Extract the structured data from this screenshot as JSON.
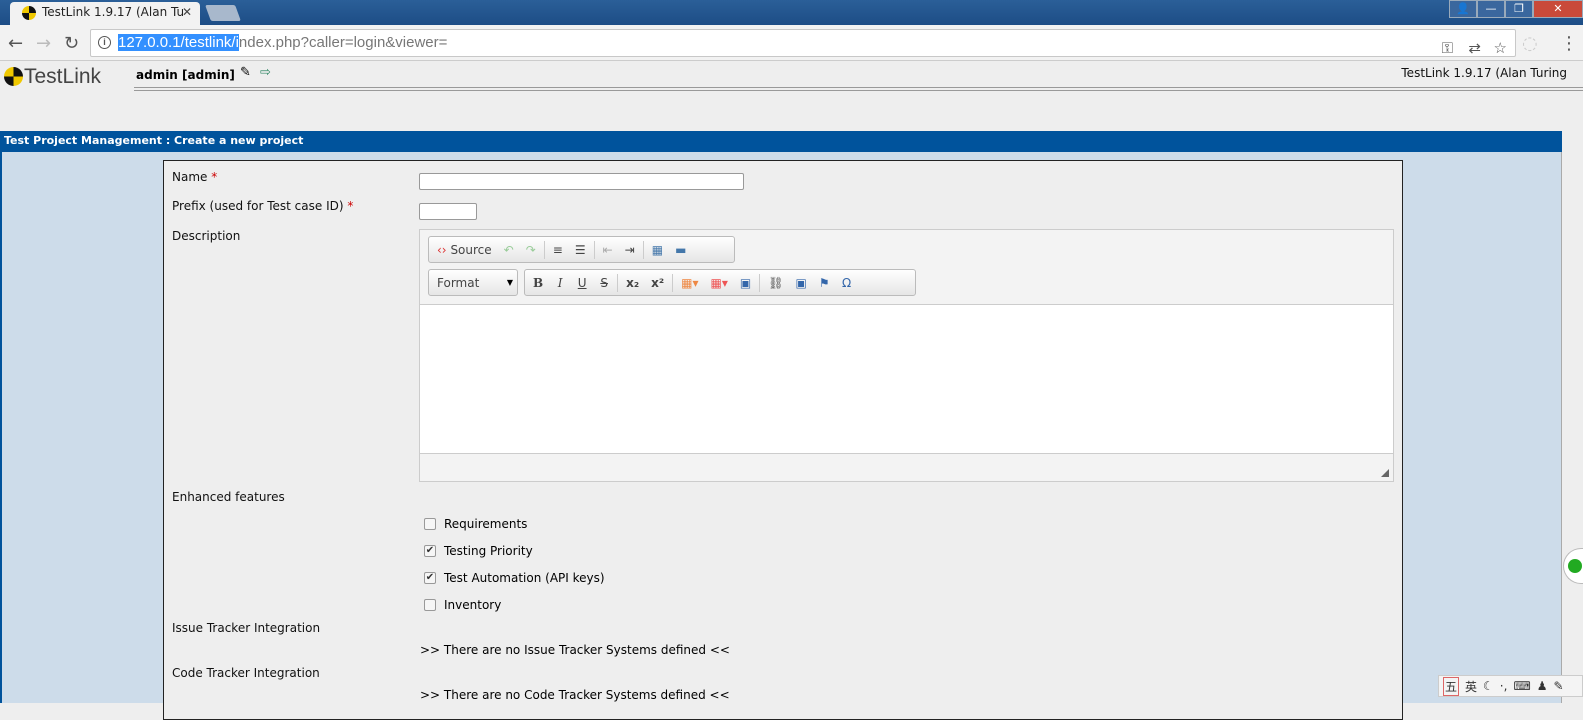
{
  "browser": {
    "tab_title": "TestLink 1.9.17 (Alan Tu",
    "url_selected": "127.0.0.1/testlink/i",
    "url_rest": "ndex.php?caller=login&viewer="
  },
  "header": {
    "logo": "TestLink",
    "user": "admin [admin]",
    "version": "TestLink 1.9.17 (Alan Turing"
  },
  "page": {
    "title": "Test Project Management : Create a new project"
  },
  "form": {
    "name_label": "Name",
    "prefix_label": "Prefix (used for Test case ID)",
    "required_mark": "*",
    "description_label": "Description",
    "editor": {
      "source": "Source",
      "format": "Format"
    },
    "enhanced_label": "Enhanced features",
    "features": [
      {
        "label": "Requirements",
        "checked": false
      },
      {
        "label": "Testing Priority",
        "checked": true
      },
      {
        "label": "Test Automation (API keys)",
        "checked": true
      },
      {
        "label": "Inventory",
        "checked": false
      }
    ],
    "issue_tracker_label": "Issue Tracker Integration",
    "issue_tracker_msg": ">> There are no Issue Tracker Systems defined <<",
    "code_tracker_label": "Code Tracker Integration",
    "code_tracker_msg": ">> There are no Code Tracker Systems defined <<"
  },
  "ime": {
    "items": [
      "五",
      "英"
    ]
  },
  "colors": {
    "title_bar": "#00539c",
    "body_bg": "#cddcea",
    "panel_bg": "#eeeeee"
  }
}
